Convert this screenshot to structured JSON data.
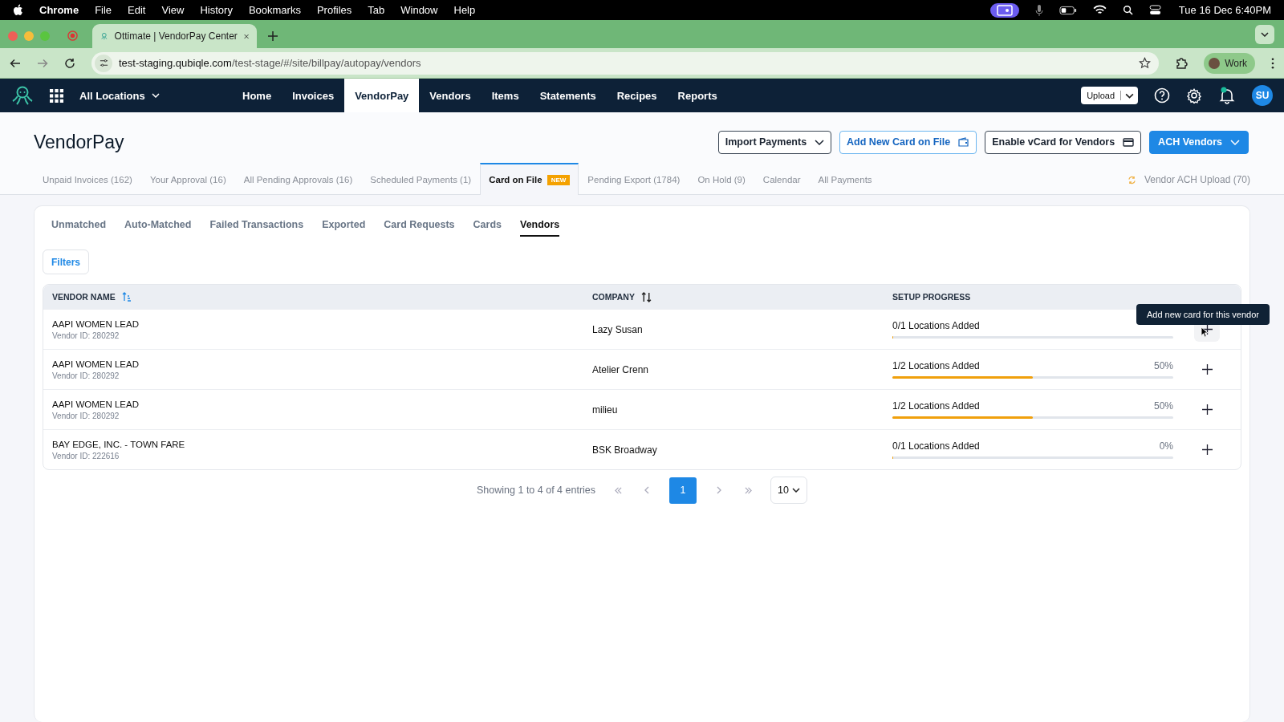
{
  "menu_bar": {
    "app": "Chrome",
    "items": [
      "File",
      "Edit",
      "View",
      "History",
      "Bookmarks",
      "Profiles",
      "Tab",
      "Window",
      "Help"
    ],
    "clock": "Tue 16 Dec  6:40PM"
  },
  "browser": {
    "tab_title": "Ottimate | VendorPay Center",
    "url_host": "test-staging.qubiqle.com",
    "url_path": "/test-stage/#/site/billpay/autopay/vendors",
    "profile": "Work"
  },
  "app_nav": {
    "location": "All Locations",
    "items": [
      {
        "label": "Home",
        "selected": false
      },
      {
        "label": "Invoices",
        "selected": false
      },
      {
        "label": "VendorPay",
        "selected": true
      },
      {
        "label": "Vendors",
        "selected": false
      },
      {
        "label": "Items",
        "selected": false
      },
      {
        "label": "Statements",
        "selected": false
      },
      {
        "label": "Recipes",
        "selected": false
      },
      {
        "label": "Reports",
        "selected": false
      }
    ],
    "upload": "Upload",
    "avatar": "SU",
    "notification_dot": true
  },
  "page": {
    "title": "VendorPay",
    "actions": [
      {
        "label": "Import Payments",
        "kind": "dropdown"
      },
      {
        "label": "Add New Card on File",
        "kind": "card-outline"
      },
      {
        "label": "Enable vCard for Vendors",
        "kind": "card"
      },
      {
        "label": "ACH Vendors",
        "kind": "primary"
      }
    ]
  },
  "tabs": [
    {
      "label": "Unpaid Invoices (162)",
      "selected": false
    },
    {
      "label": "Your Approval (16)",
      "selected": false
    },
    {
      "label": "All Pending Approvals (16)",
      "selected": false
    },
    {
      "label": "Scheduled Payments (1)",
      "selected": false
    },
    {
      "label": "Card on File",
      "badge": "NEW",
      "selected": true
    },
    {
      "label": "Pending Export (1784)",
      "selected": false
    },
    {
      "label": "On Hold (9)",
      "selected": false
    },
    {
      "label": "Calendar",
      "selected": false
    },
    {
      "label": "All Payments",
      "selected": false
    }
  ],
  "ach_upload": "Vendor ACH Upload (70)",
  "sub_tabs": [
    {
      "label": "Unmatched",
      "selected": false
    },
    {
      "label": "Auto-Matched",
      "selected": false
    },
    {
      "label": "Failed Transactions",
      "selected": false
    },
    {
      "label": "Exported",
      "selected": false
    },
    {
      "label": "Card Requests",
      "selected": false
    },
    {
      "label": "Cards",
      "selected": false
    },
    {
      "label": "Vendors",
      "selected": true
    }
  ],
  "filters": "Filters",
  "table": {
    "columns": [
      "VENDOR NAME",
      "COMPANY",
      "SETUP PROGRESS"
    ],
    "rows": [
      {
        "vendor": "AAPI WOMEN LEAD",
        "vendor_id": "Vendor ID: 280292",
        "company": "Lazy Susan",
        "progress": "0/1 Locations Added",
        "level": 0
      },
      {
        "vendor": "AAPI WOMEN LEAD",
        "vendor_id": "Vendor ID: 280292",
        "company": "Atelier Crenn",
        "progress": "1/2 Locations Added",
        "percent": "50%",
        "level": 0.5
      },
      {
        "vendor": "AAPI WOMEN LEAD",
        "vendor_id": "Vendor ID: 280292",
        "company": "milieu",
        "progress": "1/2 Locations Added",
        "percent": "50%",
        "level": 0.5
      },
      {
        "vendor": "BAY EDGE, INC. - TOWN FARE",
        "vendor_id": "Vendor ID: 222616",
        "company": "BSK Broadway",
        "progress": "0/1 Locations Added",
        "percent": "0%",
        "level": 0
      }
    ]
  },
  "tooltip": "Add new card for this vendor",
  "pagination": {
    "summary": "Showing 1 to 4 of 4 entries",
    "pages": [
      {
        "label": "1",
        "selected": true
      }
    ],
    "page_size": "10"
  }
}
